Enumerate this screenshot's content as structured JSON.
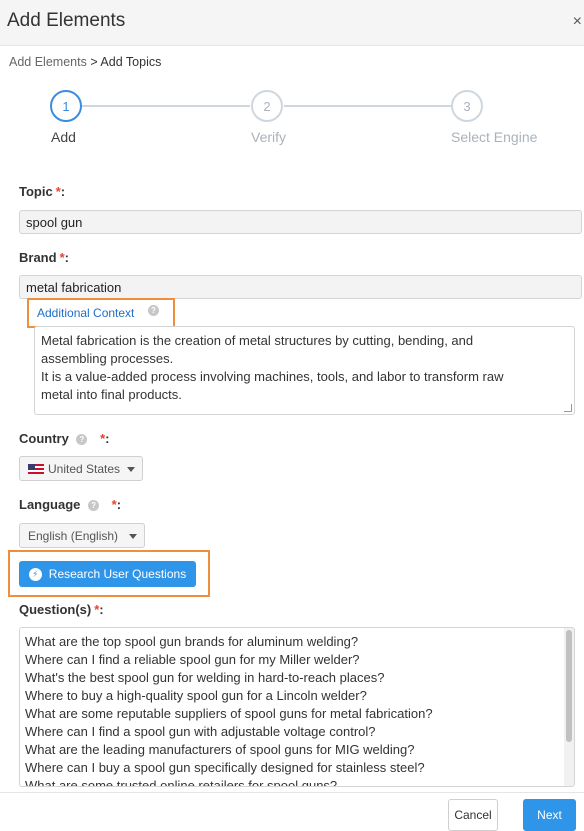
{
  "modal": {
    "title": "Add Elements",
    "close_glyph": "×"
  },
  "breadcrumb": {
    "parent": "Add Elements",
    "separator": ">",
    "current": "Add Topics"
  },
  "stepper": {
    "steps": [
      {
        "number": "1",
        "label": "Add"
      },
      {
        "number": "2",
        "label": "Verify"
      },
      {
        "number": "3",
        "label": "Select Engine"
      }
    ],
    "active_index": 0
  },
  "form": {
    "required_mark": "*",
    "label_colon": ":",
    "topic": {
      "label": "Topic",
      "value": "spool gun"
    },
    "brand": {
      "label": "Brand",
      "value": "metal fabrication"
    },
    "additional_context": {
      "link_label": "Additional Context",
      "help_glyph": "?",
      "lines": [
        "Metal fabrication is the creation of metal structures by cutting, bending, and",
        "assembling processes.",
        "It is a value-added process involving machines, tools, and labor to transform raw",
        "metal into final products."
      ]
    },
    "country": {
      "label": "Country",
      "help_glyph": "?",
      "selected": "United States"
    },
    "language": {
      "label": "Language",
      "help_glyph": "?",
      "selected": "English (English)"
    },
    "research_button": {
      "label": "Research User Questions",
      "icon_glyph": "⚡"
    },
    "questions": {
      "label": "Question(s)",
      "items": [
        "What are the top spool gun brands for aluminum welding?",
        "Where can I find a reliable spool gun for my Miller welder?",
        "What's the best spool gun for welding in hard-to-reach places?",
        "Where to buy a high-quality spool gun for a Lincoln welder?",
        "What are some reputable suppliers of spool guns for metal fabrication?",
        "Where can I find a spool gun with adjustable voltage control?",
        "What are the leading manufacturers of spool guns for MIG welding?",
        "Where can I buy a spool gun specifically designed for stainless steel?",
        "What are some trusted online retailers for spool guns?"
      ]
    }
  },
  "footer": {
    "cancel_label": "Cancel",
    "next_label": "Next"
  },
  "colors": {
    "accent": "#2f95e8",
    "highlight_box": "#ef8f3b",
    "required": "#e8422f"
  }
}
